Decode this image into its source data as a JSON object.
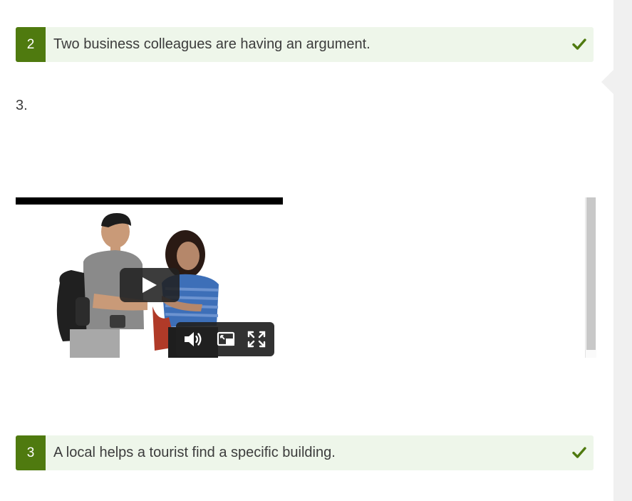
{
  "answers": [
    {
      "number": "2",
      "text": "Two business colleagues are having an argument."
    },
    {
      "number": "3",
      "text": "A local helps a tourist find a specific building."
    }
  ],
  "question": {
    "label": "3."
  },
  "colors": {
    "accent_green": "#4f7a0f",
    "row_bg": "#eef6ea",
    "check_green": "#4f7a0f",
    "panel_gray": "#f0f0f0"
  },
  "icons": {
    "check": "check-icon",
    "play": "play-icon",
    "volume": "volume-icon",
    "pip": "picture-in-picture-icon",
    "fullscreen": "fullscreen-icon"
  }
}
